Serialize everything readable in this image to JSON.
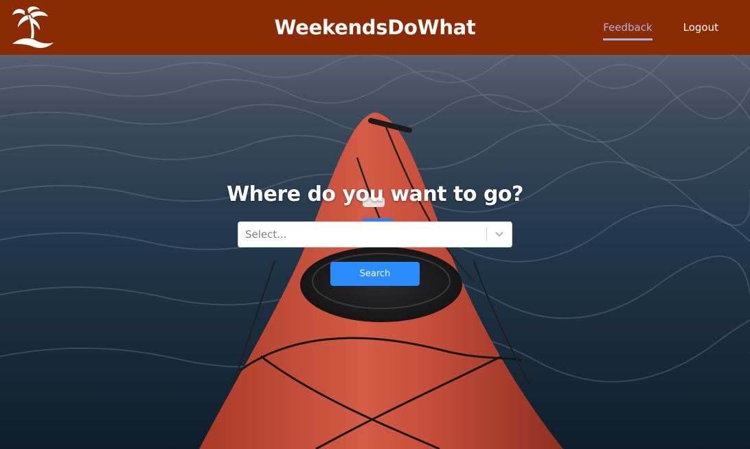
{
  "navbar": {
    "brand": "WeekendsDoWhat",
    "logo_icon": "palm-tree-icon",
    "links": [
      {
        "label": "Feedback",
        "active": true
      },
      {
        "label": "Logout",
        "active": false
      }
    ],
    "background_color": "#8b2b04",
    "active_link_color": "#a8b4e8"
  },
  "search": {
    "title": "Where do you want to go?",
    "select_placeholder": "Select...",
    "select_icon": "chevron-down-icon",
    "button_label": "Search",
    "button_color": "#2b8cff"
  }
}
